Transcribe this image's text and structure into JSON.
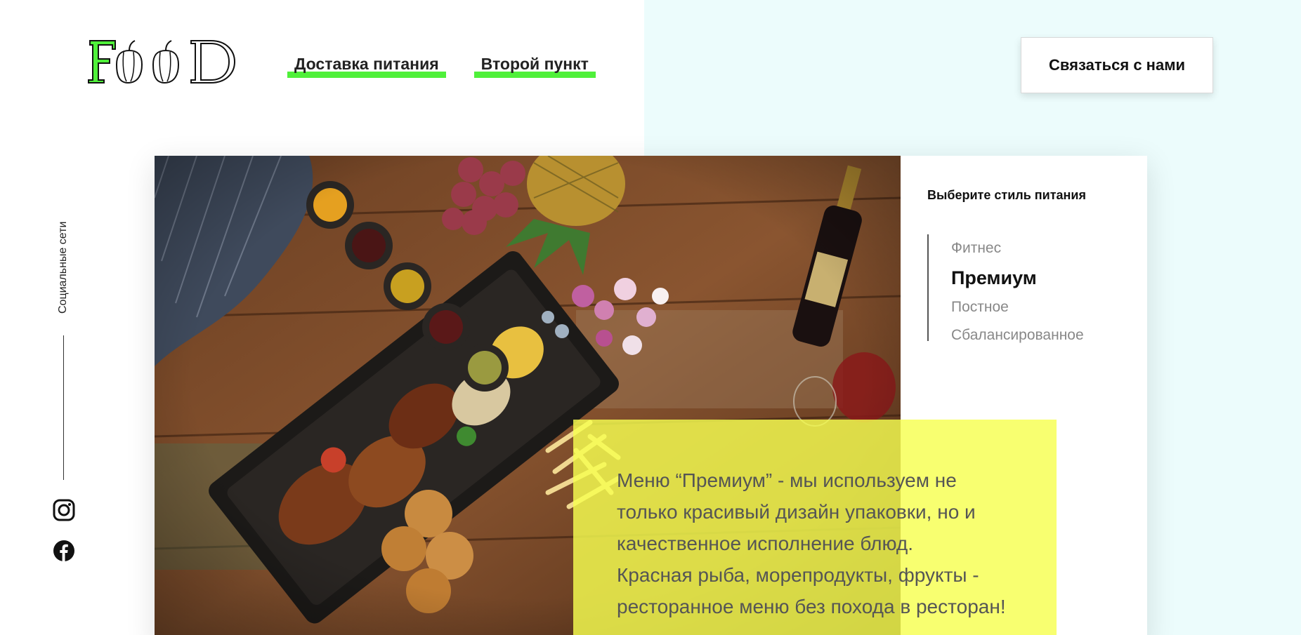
{
  "header": {
    "logo_text": "FOOD",
    "nav": [
      {
        "label": "Доставка питания"
      },
      {
        "label": "Второй пункт"
      }
    ],
    "contact_label": "Связаться с нами"
  },
  "sidebar": {
    "social_label": "Социальные сети",
    "icons": [
      "instagram-icon",
      "facebook-icon"
    ]
  },
  "style_panel": {
    "title": "Выберите стиль питания",
    "items": [
      {
        "label": "Фитнес",
        "active": false
      },
      {
        "label": "Премиум",
        "active": true
      },
      {
        "label": "Постное",
        "active": false
      },
      {
        "label": "Сбалансированное",
        "active": false
      }
    ]
  },
  "description": {
    "paragraph_1": "Меню “Премиум” - мы используем не только красивый дизайн упаковки, но и качественное исполнение блюд.",
    "paragraph_2": "Красная рыба, морепродукты, фрукты - ресторанное меню без похода в ресторан!"
  },
  "colors": {
    "accent_green": "#4ff03a",
    "panel_bg": "#ecfcfc",
    "highlight_yellow": "#f6ff50"
  }
}
